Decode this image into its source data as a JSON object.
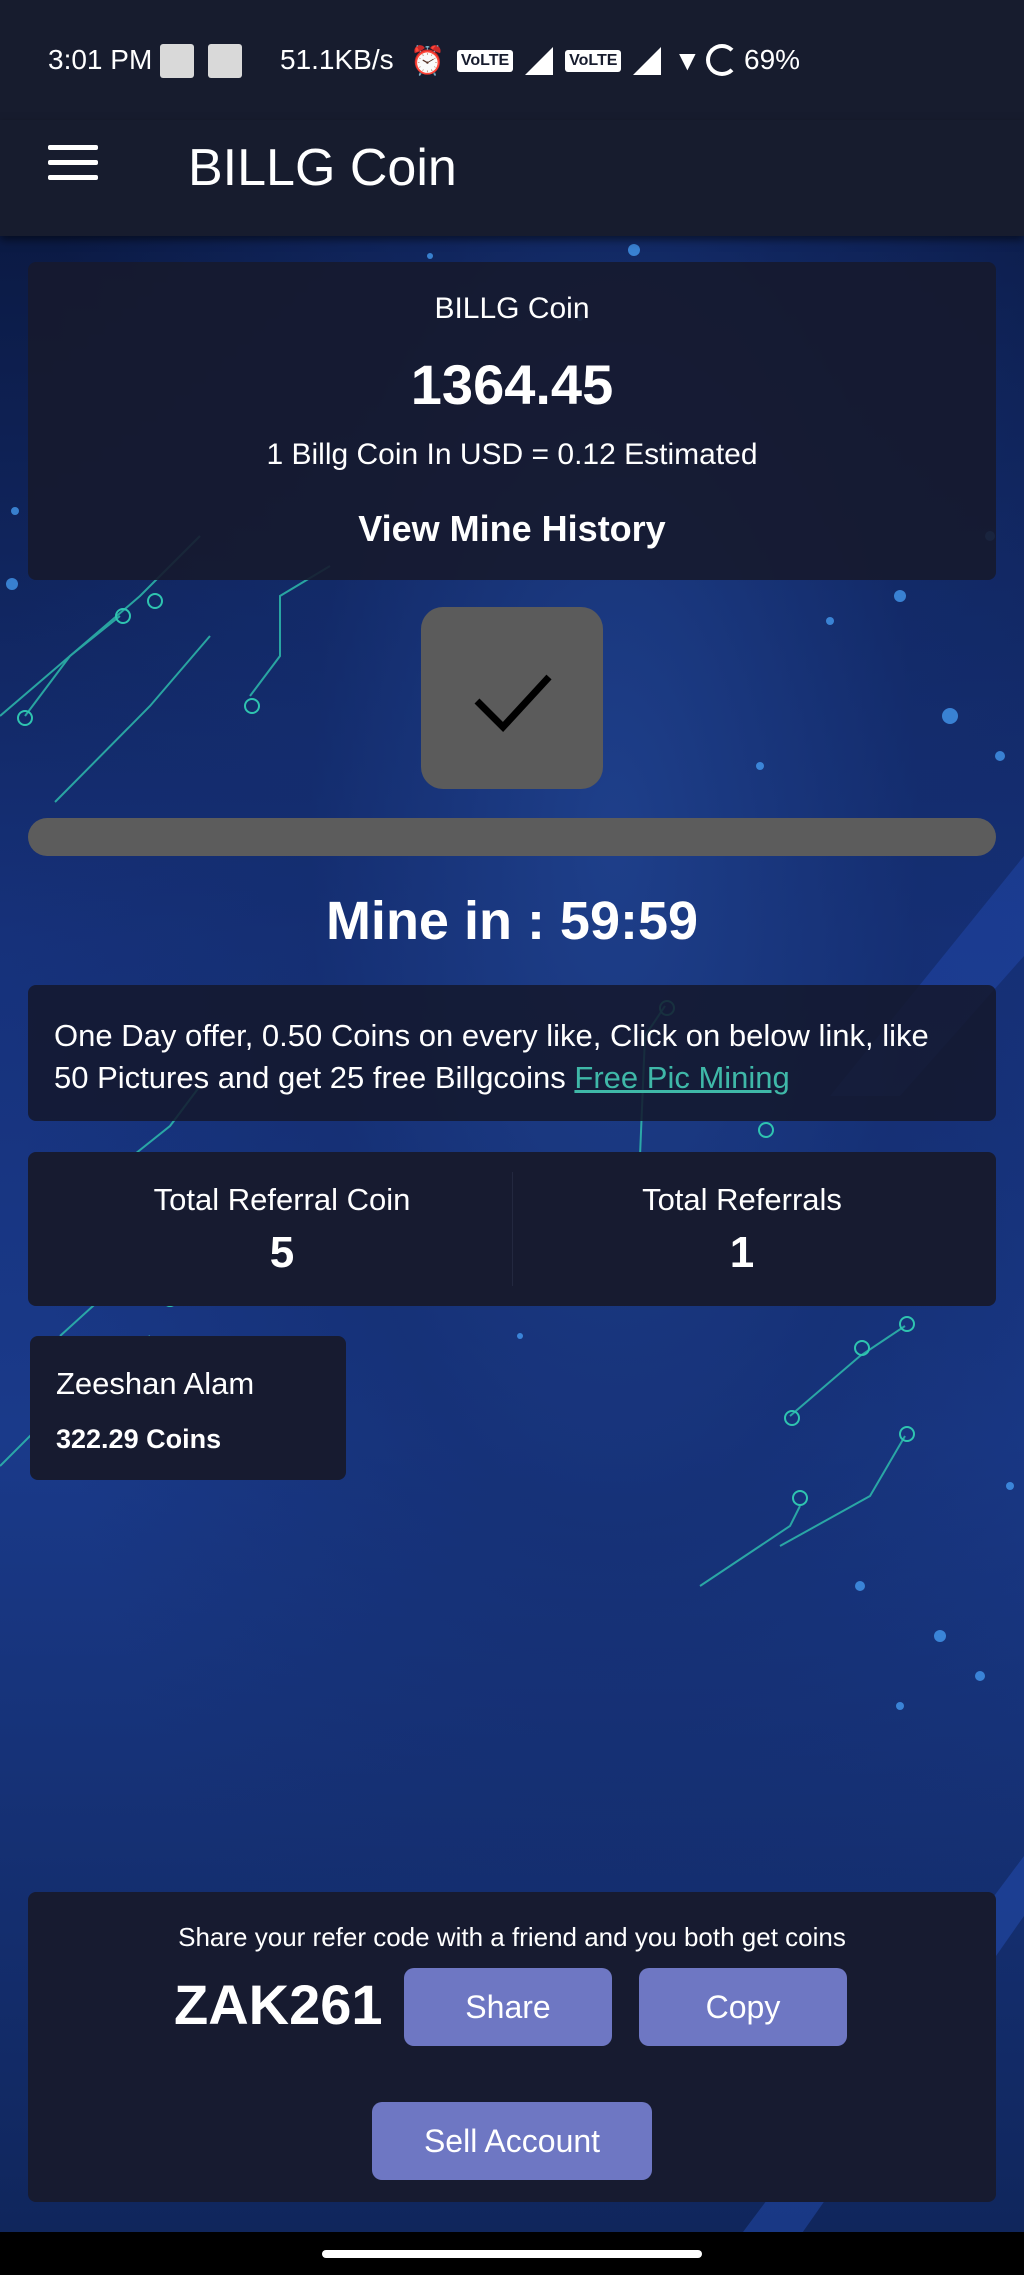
{
  "status_bar": {
    "time": "3:01 PM",
    "network_speed": "51.1KB/s",
    "volte1": "VoLTE",
    "volte2": "VoLTE",
    "battery": "69%",
    "icons": [
      "alarm-icon",
      "signal-icon",
      "wifi-icon",
      "battery-icon"
    ]
  },
  "app_bar": {
    "title": "BILLG Coin",
    "menu_icon": "hamburger-menu-icon"
  },
  "balance": {
    "title": "BILLG Coin",
    "amount": "1364.45",
    "rate": "1 Billg Coin In USD = 0.12 Estimated",
    "history_link": "View Mine History"
  },
  "mining": {
    "button_icon": "checkmark-icon",
    "progress": 1.0,
    "timer": "Mine in : 59:59"
  },
  "offer": {
    "text": "One Day offer, 0.50 Coins on every like, Click on below link, like 50 Pictures and get 25 free Billgcoins ",
    "link": "Free Pic Mining"
  },
  "referrals": {
    "coin_label": "Total Referral Coin",
    "coin_value": "5",
    "count_label": "Total Referrals",
    "count_value": "1"
  },
  "referral_list": [
    {
      "name": "Zeeshan Alam",
      "coins": "322.29 Coins"
    }
  ],
  "refer": {
    "message": "Share your refer code with a friend and you both get coins",
    "code": "ZAK261",
    "share_label": "Share",
    "copy_label": "Copy",
    "sell_label": "Sell Account"
  },
  "colors": {
    "app_bar": "#171c2e",
    "button": "#6e77c3",
    "link": "#3fb8a8",
    "background": "#1a3a8a"
  }
}
